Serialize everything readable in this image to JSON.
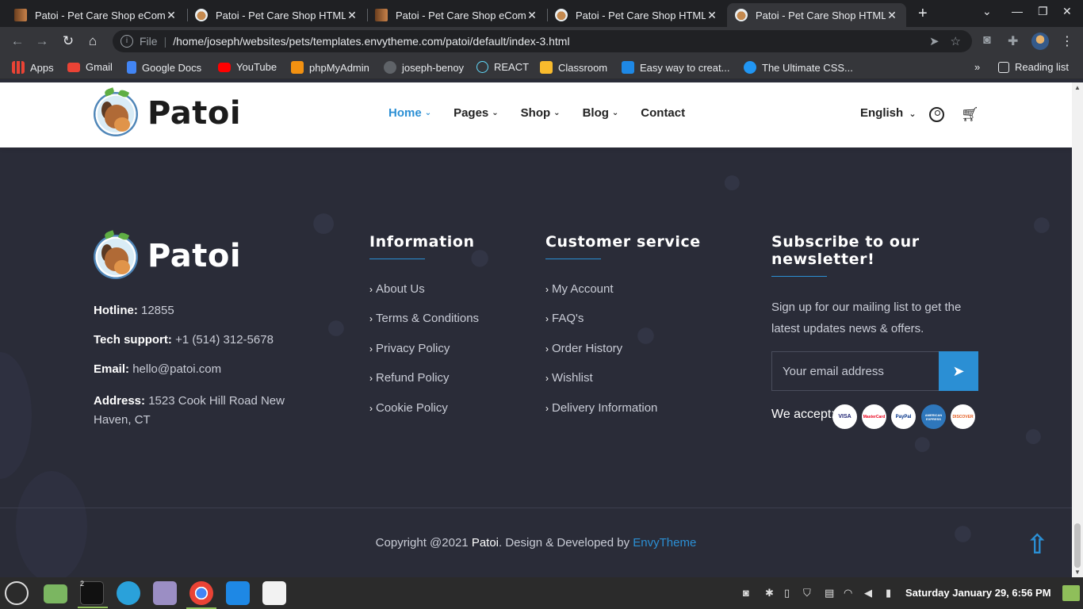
{
  "browser": {
    "tabs": [
      {
        "title": "Patoi - Pet Care Shop eCommerce",
        "icon": "book-favicon"
      },
      {
        "title": "Patoi - Pet Care Shop HTML Template",
        "icon": "dog-favicon"
      },
      {
        "title": "Patoi - Pet Care Shop eCommerce",
        "icon": "book-favicon"
      },
      {
        "title": "Patoi - Pet Care Shop HTML Template",
        "icon": "dog-favicon"
      },
      {
        "title": "Patoi - Pet Care Shop HTML Template",
        "icon": "dog-favicon"
      }
    ],
    "active_tab": 4,
    "omnibox": {
      "scheme_label": "File",
      "url": "/home/joseph/websites/pets/templates.envytheme.com/patoi/default/index-3.html"
    },
    "bookmarks": [
      {
        "label": "Apps",
        "icon": "apps-grid-icon",
        "color": "#e8eaed"
      },
      {
        "label": "Gmail",
        "icon": "gmail-icon",
        "color": "#ea4335"
      },
      {
        "label": "Google Docs",
        "icon": "docs-icon",
        "color": "#4285f4"
      },
      {
        "label": "YouTube",
        "icon": "youtube-icon",
        "color": "#ff0000"
      },
      {
        "label": "phpMyAdmin",
        "icon": "phpmyadmin-icon",
        "color": "#f29111"
      },
      {
        "label": "joseph-benoy",
        "icon": "github-icon",
        "color": "#9aa0a6"
      },
      {
        "label": "REACT",
        "icon": "react-icon",
        "color": "#61dafb"
      },
      {
        "label": "Classroom",
        "icon": "classroom-icon",
        "color": "#f9bb2d"
      },
      {
        "label": "Easy way to creat...",
        "icon": "lc-icon",
        "color": "#1e88e5"
      },
      {
        "label": "The Ultimate CSS...",
        "icon": "code-icon",
        "color": "#2196f3"
      }
    ],
    "reading_list": "Reading list"
  },
  "header": {
    "brand": "Patoi",
    "nav": [
      {
        "label": "Home",
        "active": true,
        "dropdown": true
      },
      {
        "label": "Pages",
        "active": false,
        "dropdown": true
      },
      {
        "label": "Shop",
        "active": false,
        "dropdown": true
      },
      {
        "label": "Blog",
        "active": false,
        "dropdown": true
      },
      {
        "label": "Contact",
        "active": false,
        "dropdown": false
      }
    ],
    "language": "English"
  },
  "footer": {
    "brand": "Patoi",
    "contact": [
      {
        "key": "Hotline:",
        "value": "12855"
      },
      {
        "key": "Tech support:",
        "value": "+1 (514) 312-5678"
      },
      {
        "key": "Email:",
        "value": "hello@patoi.com"
      },
      {
        "key": "Address:",
        "value": "1523 Cook Hill Road New Haven, CT"
      }
    ],
    "information": {
      "title": "Information",
      "links": [
        "About Us",
        "Terms & Conditions",
        "Privacy Policy",
        "Refund Policy",
        "Cookie Policy"
      ]
    },
    "customer_service": {
      "title": "Customer service",
      "links": [
        "My Account",
        "FAQ's",
        "Order History",
        "Wishlist",
        "Delivery Information"
      ]
    },
    "newsletter": {
      "title": "Subscribe to our newsletter!",
      "text": "Sign up for our mailing list to get the latest updates news & offers.",
      "placeholder": "Your email address",
      "we_accept": "We accept:",
      "payments": [
        {
          "label": "VISA",
          "color": "#1a1f71"
        },
        {
          "label": "MasterCard",
          "color": "#eb001b"
        },
        {
          "label": "PayPal",
          "color": "#003087"
        },
        {
          "label": "AMERICAN EXPRESS",
          "color": "#2e77bc"
        },
        {
          "label": "DISCOVER",
          "color": "#e55c20"
        }
      ]
    },
    "copyright": {
      "prefix": "Copyright @2021 ",
      "brand": "Patoi",
      "middle": ". Design & Developed by ",
      "developer": "EnvyTheme"
    }
  },
  "taskbar": {
    "terminal_badge": "2",
    "clock": "Saturday January 29, 6:56 PM"
  },
  "colors": {
    "accent": "#2b8fd4",
    "footer_bg": "#2a2c38"
  }
}
